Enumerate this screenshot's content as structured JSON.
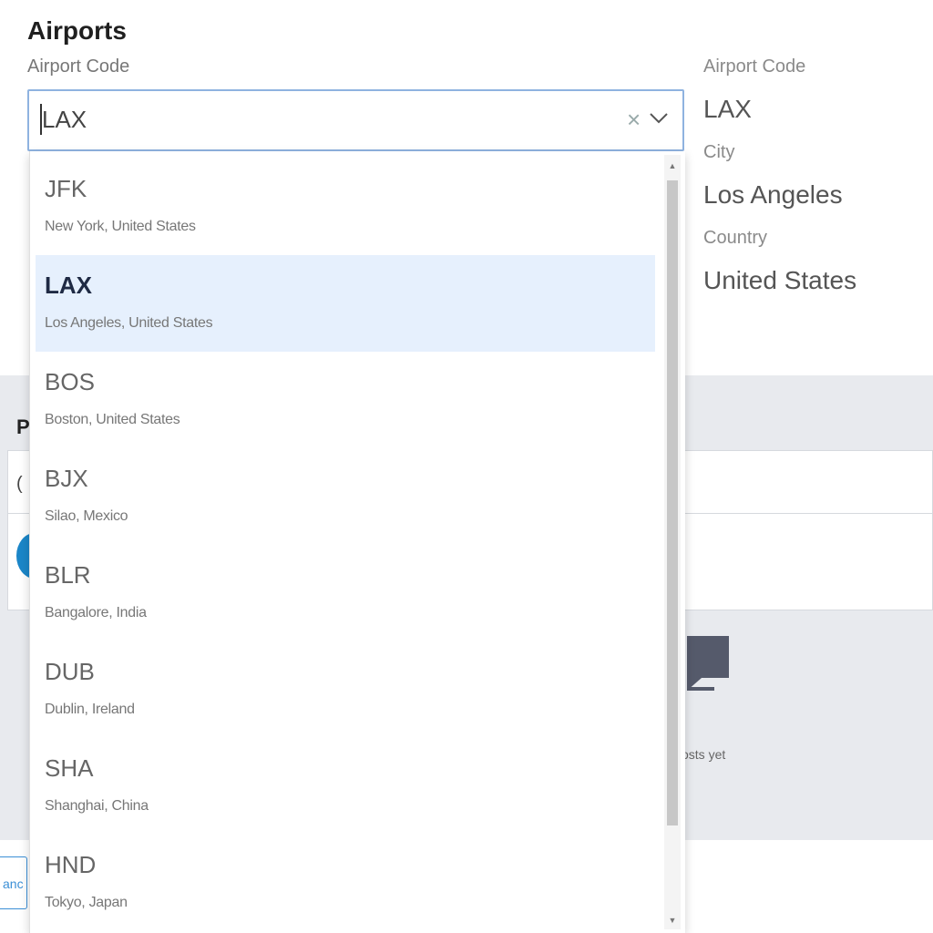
{
  "airports": {
    "title": "Airports",
    "field_label": "Airport Code",
    "combo_value": "LAX",
    "clear_glyph": "×",
    "details": {
      "code_label": "Airport Code",
      "code_value": "LAX",
      "city_label": "City",
      "city_value": "Los Angeles",
      "country_label": "Country",
      "country_value": "United States"
    },
    "options": [
      {
        "code": "JFK",
        "sub": "New York, United States"
      },
      {
        "code": "LAX",
        "sub": "Los Angeles, United States",
        "selected": true
      },
      {
        "code": "BOS",
        "sub": "Boston, United States"
      },
      {
        "code": "BJX",
        "sub": "Silao, Mexico"
      },
      {
        "code": "BLR",
        "sub": "Bangalore, India"
      },
      {
        "code": "DUB",
        "sub": "Dublin, Ireland"
      },
      {
        "code": "SHA",
        "sub": "Shanghai, China"
      },
      {
        "code": "HND",
        "sub": "Tokyo, Japan"
      }
    ]
  },
  "background": {
    "letter": "P",
    "letter2": "(",
    "no_posts_fragment": "osts yet",
    "bottom_button_fragment": "anc"
  },
  "icons": {
    "scroll_up": "▲",
    "scroll_down": "▼"
  },
  "colors": {
    "accent": "#8fb3e0",
    "selected_bg": "#e6f0fd",
    "band": "#e8eaee",
    "chat_icon": "#555a6b"
  }
}
